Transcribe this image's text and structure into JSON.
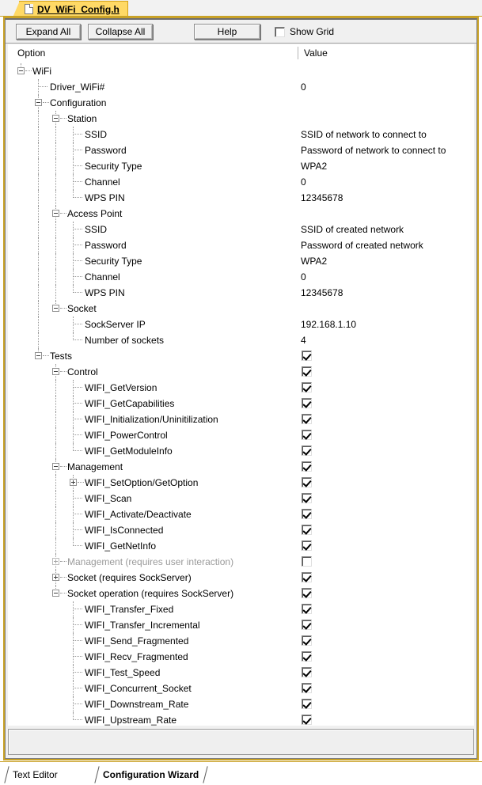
{
  "document_tab": {
    "label": "DV_WiFi_Config.h",
    "icon": "file-icon"
  },
  "toolbar": {
    "expand_all_label": "Expand All",
    "collapse_all_label": "Collapse All",
    "help_label": "Help",
    "show_grid_label": "Show Grid",
    "show_grid_checked": false
  },
  "tree": {
    "columns": {
      "option": "Option",
      "value": "Value"
    },
    "rows": [
      {
        "indent": 0,
        "toggle": "minus",
        "label": "WiFi",
        "value": ""
      },
      {
        "indent": 1,
        "toggle": "none",
        "label": "Driver_WiFi#",
        "value": "0"
      },
      {
        "indent": 1,
        "toggle": "minus",
        "label": "Configuration",
        "value": ""
      },
      {
        "indent": 2,
        "toggle": "minus",
        "label": "Station",
        "value": ""
      },
      {
        "indent": 3,
        "toggle": "none",
        "label": "SSID",
        "value": "SSID of network to connect to"
      },
      {
        "indent": 3,
        "toggle": "none",
        "label": "Password",
        "value": "Password of network to connect to"
      },
      {
        "indent": 3,
        "toggle": "none",
        "label": "Security Type",
        "value": "WPA2"
      },
      {
        "indent": 3,
        "toggle": "none",
        "label": "Channel",
        "value": "0"
      },
      {
        "indent": 3,
        "toggle": "none",
        "label": "WPS PIN",
        "value": "12345678"
      },
      {
        "indent": 2,
        "toggle": "minus",
        "label": "Access Point",
        "value": ""
      },
      {
        "indent": 3,
        "toggle": "none",
        "label": "SSID",
        "value": "SSID of created network"
      },
      {
        "indent": 3,
        "toggle": "none",
        "label": "Password",
        "value": "Password of created network"
      },
      {
        "indent": 3,
        "toggle": "none",
        "label": "Security Type",
        "value": "WPA2"
      },
      {
        "indent": 3,
        "toggle": "none",
        "label": "Channel",
        "value": "0"
      },
      {
        "indent": 3,
        "toggle": "none",
        "label": "WPS PIN",
        "value": "12345678"
      },
      {
        "indent": 2,
        "toggle": "minus",
        "label": "Socket",
        "value": ""
      },
      {
        "indent": 3,
        "toggle": "none",
        "label": "SockServer IP",
        "value": "192.168.1.10"
      },
      {
        "indent": 3,
        "toggle": "none",
        "label": "Number of sockets",
        "value": "4"
      },
      {
        "indent": 1,
        "toggle": "minus",
        "label": "Tests",
        "checkbox": true,
        "checked": true
      },
      {
        "indent": 2,
        "toggle": "minus",
        "label": "Control",
        "checkbox": true,
        "checked": true
      },
      {
        "indent": 3,
        "toggle": "none",
        "label": "WIFI_GetVersion",
        "checkbox": true,
        "checked": true
      },
      {
        "indent": 3,
        "toggle": "none",
        "label": "WIFI_GetCapabilities",
        "checkbox": true,
        "checked": true
      },
      {
        "indent": 3,
        "toggle": "none",
        "label": "WIFI_Initialization/Uninitilization",
        "checkbox": true,
        "checked": true
      },
      {
        "indent": 3,
        "toggle": "none",
        "label": "WIFI_PowerControl",
        "checkbox": true,
        "checked": true
      },
      {
        "indent": 3,
        "toggle": "none",
        "label": "WIFI_GetModuleInfo",
        "checkbox": true,
        "checked": true
      },
      {
        "indent": 2,
        "toggle": "minus",
        "label": "Management",
        "checkbox": true,
        "checked": true
      },
      {
        "indent": 3,
        "toggle": "plus",
        "label": "WIFI_SetOption/GetOption",
        "checkbox": true,
        "checked": true
      },
      {
        "indent": 3,
        "toggle": "none",
        "label": "WIFI_Scan",
        "checkbox": true,
        "checked": true
      },
      {
        "indent": 3,
        "toggle": "none",
        "label": "WIFI_Activate/Deactivate",
        "checkbox": true,
        "checked": true
      },
      {
        "indent": 3,
        "toggle": "none",
        "label": "WIFI_IsConnected",
        "checkbox": true,
        "checked": true
      },
      {
        "indent": 3,
        "toggle": "none",
        "label": "WIFI_GetNetInfo",
        "checkbox": true,
        "checked": true
      },
      {
        "indent": 2,
        "toggle": "plus",
        "label": "Management (requires user interaction)",
        "checkbox": true,
        "checked": false,
        "dim": true
      },
      {
        "indent": 2,
        "toggle": "plus",
        "label": "Socket (requires SockServer)",
        "checkbox": true,
        "checked": true
      },
      {
        "indent": 2,
        "toggle": "minus",
        "label": "Socket operation (requires SockServer)",
        "checkbox": true,
        "checked": true
      },
      {
        "indent": 3,
        "toggle": "none",
        "label": "WIFI_Transfer_Fixed",
        "checkbox": true,
        "checked": true
      },
      {
        "indent": 3,
        "toggle": "none",
        "label": "WIFI_Transfer_Incremental",
        "checkbox": true,
        "checked": true
      },
      {
        "indent": 3,
        "toggle": "none",
        "label": "WIFI_Send_Fragmented",
        "checkbox": true,
        "checked": true
      },
      {
        "indent": 3,
        "toggle": "none",
        "label": "WIFI_Recv_Fragmented",
        "checkbox": true,
        "checked": true
      },
      {
        "indent": 3,
        "toggle": "none",
        "label": "WIFI_Test_Speed",
        "checkbox": true,
        "checked": true
      },
      {
        "indent": 3,
        "toggle": "none",
        "label": "WIFI_Concurrent_Socket",
        "checkbox": true,
        "checked": true
      },
      {
        "indent": 3,
        "toggle": "none",
        "label": "WIFI_Downstream_Rate",
        "checkbox": true,
        "checked": true
      },
      {
        "indent": 3,
        "toggle": "none",
        "label": "WIFI_Upstream_Rate",
        "checkbox": true,
        "checked": true
      }
    ]
  },
  "bottom_tabs": [
    {
      "label": "Text Editor",
      "active": false
    },
    {
      "label": "Configuration Wizard",
      "active": true
    }
  ],
  "colors": {
    "tab_accent": "#ffd966",
    "frame_border": "#c9a227",
    "panel_bg": "#f0f0f0",
    "dim_text": "#9a9a9a"
  }
}
